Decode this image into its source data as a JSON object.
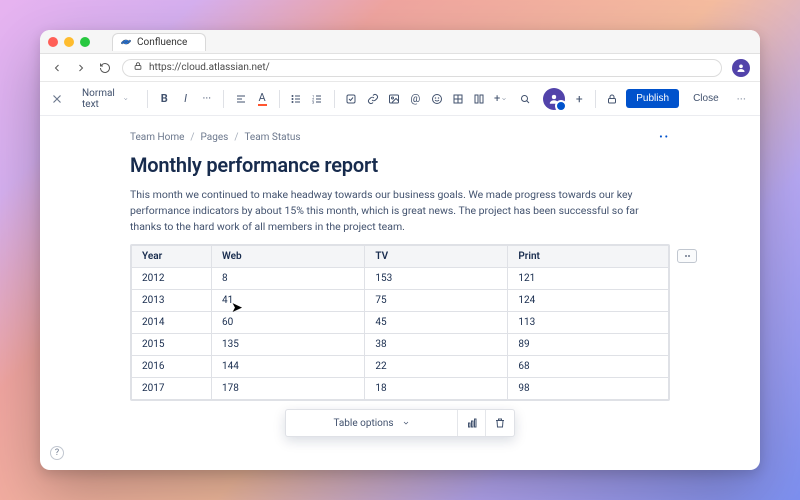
{
  "browser": {
    "tab_title": "Confluence",
    "url": "https://cloud.atlassian.net/"
  },
  "toolbar": {
    "style_dropdown": "Normal text",
    "publish": "Publish",
    "close": "Close"
  },
  "breadcrumbs": [
    "Team Home",
    "Pages",
    "Team Status"
  ],
  "page": {
    "title": "Monthly performance report",
    "paragraph": "This month we continued to make headway towards our business goals. We made progress towards our key performance indicators by about 15% this month, which is great news. The project has been successful so far thanks to the hard work of all members in the project team."
  },
  "table": {
    "headers": [
      "Year",
      "Web",
      "TV",
      "Print"
    ],
    "rows": [
      [
        "2012",
        "8",
        "153",
        "121"
      ],
      [
        "2013",
        "41",
        "75",
        "124"
      ],
      [
        "2014",
        "60",
        "45",
        "113"
      ],
      [
        "2015",
        "135",
        "38",
        "89"
      ],
      [
        "2016",
        "144",
        "22",
        "68"
      ],
      [
        "2017",
        "178",
        "18",
        "98"
      ]
    ]
  },
  "table_tools": {
    "options_label": "Table options"
  },
  "chart_data": {
    "type": "table",
    "title": "Monthly performance report",
    "columns": [
      "Year",
      "Web",
      "TV",
      "Print"
    ],
    "series": [
      {
        "name": "Web",
        "x": [
          2012,
          2013,
          2014,
          2015,
          2016,
          2017
        ],
        "values": [
          8,
          41,
          60,
          135,
          144,
          178
        ]
      },
      {
        "name": "TV",
        "x": [
          2012,
          2013,
          2014,
          2015,
          2016,
          2017
        ],
        "values": [
          153,
          75,
          45,
          38,
          22,
          18
        ]
      },
      {
        "name": "Print",
        "x": [
          2012,
          2013,
          2014,
          2015,
          2016,
          2017
        ],
        "values": [
          121,
          124,
          113,
          89,
          68,
          98
        ]
      }
    ]
  }
}
